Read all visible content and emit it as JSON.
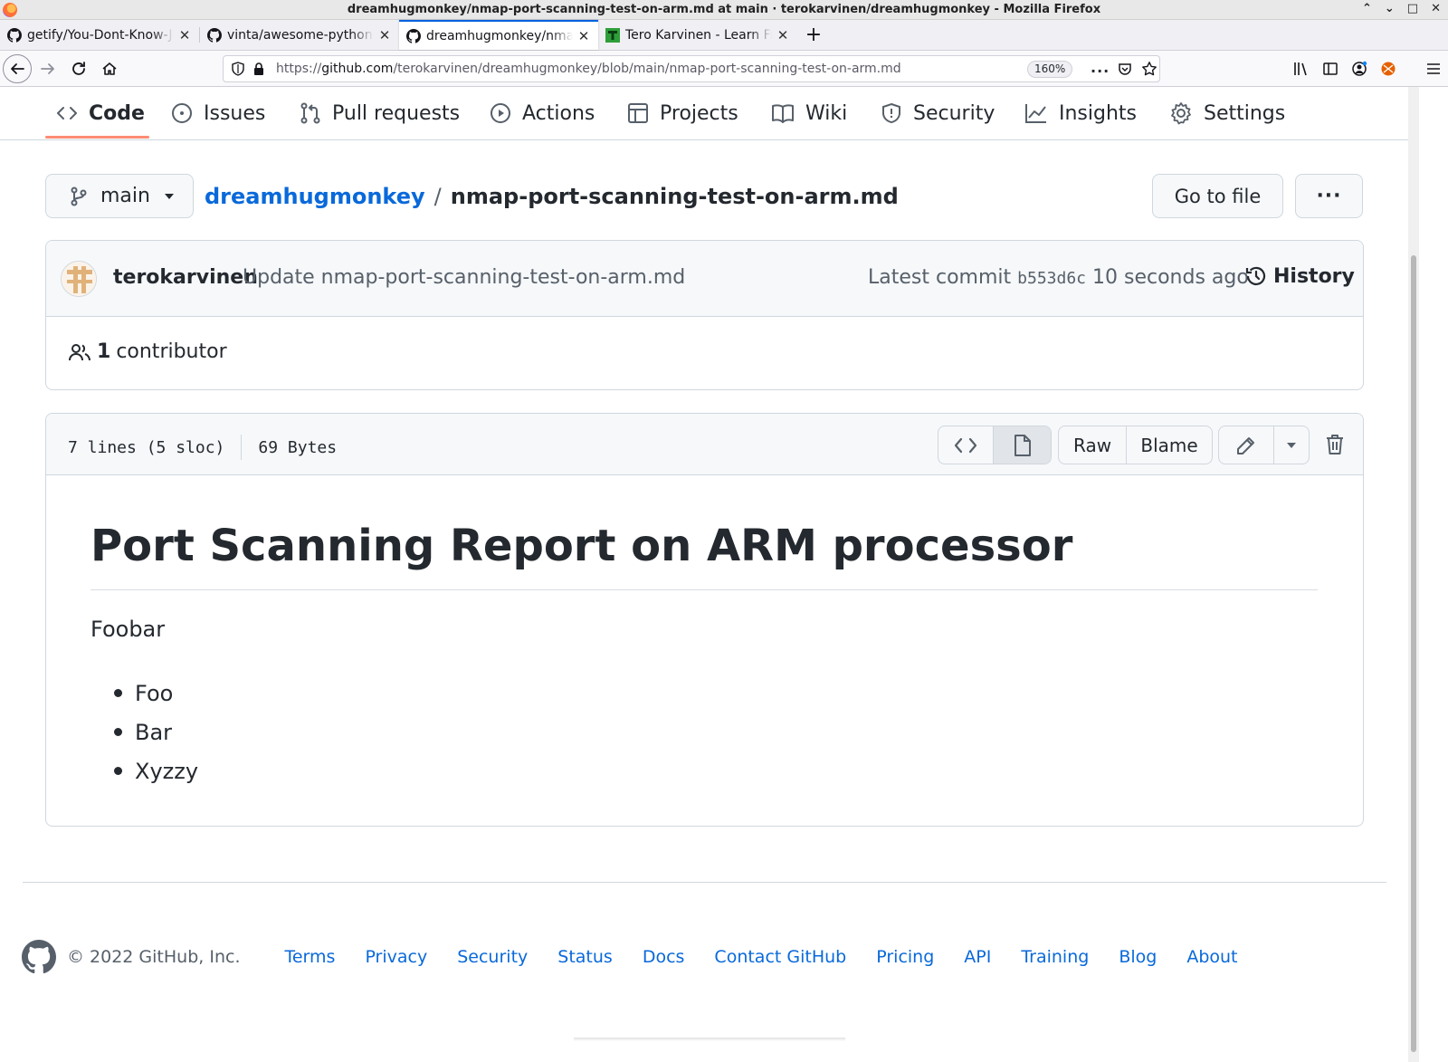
{
  "window": {
    "title": "dreamhugmonkey/nmap-port-scanning-test-on-arm.md at main · terokarvinen/dreamhugmonkey - Mozilla Firefox",
    "controls": [
      "⌃",
      "⌄",
      "□",
      "✕"
    ]
  },
  "tabs": [
    {
      "title": "getify/You-Dont-Know-JS: A",
      "icon": "github-icon",
      "active": false
    },
    {
      "title": "vinta/awesome-python: An",
      "icon": "github-icon",
      "active": false
    },
    {
      "title": "dreamhugmonkey/nmap-port",
      "icon": "github-icon",
      "active": true
    },
    {
      "title": "Tero Karvinen - Learn Free",
      "icon": "tero-favicon",
      "active": false
    }
  ],
  "navbar": {
    "url_prefix": "https://",
    "url_host": "github.com",
    "url_path": "/terokarvinen/dreamhugmonkey/blob/main/nmap-port-scanning-test-on-arm.md",
    "zoom": "160%"
  },
  "repo_nav": {
    "items": [
      {
        "label": "Code",
        "icon": "code-icon",
        "selected": true
      },
      {
        "label": "Issues",
        "icon": "issue-opened-icon"
      },
      {
        "label": "Pull requests",
        "icon": "git-pull-request-icon"
      },
      {
        "label": "Actions",
        "icon": "play-icon"
      },
      {
        "label": "Projects",
        "icon": "table-icon"
      },
      {
        "label": "Wiki",
        "icon": "book-icon"
      },
      {
        "label": "Security",
        "icon": "shield-icon"
      },
      {
        "label": "Insights",
        "icon": "graph-icon"
      },
      {
        "label": "Settings",
        "icon": "gear-icon"
      }
    ]
  },
  "file_nav": {
    "branch": "main",
    "repo": "dreamhugmonkey",
    "separator": "/",
    "file": "nmap-port-scanning-test-on-arm.md",
    "goto_label": "Go to file",
    "more_label": "···"
  },
  "commit": {
    "author": "terokarvinen",
    "message": "Update nmap-port-scanning-test-on-arm.md",
    "latest_label": "Latest commit",
    "sha": "b553d6c",
    "time": "10 seconds ago",
    "history_label": "History",
    "contributors_count": "1",
    "contributors_label": "contributor"
  },
  "file_header": {
    "lines": "7 lines (5 sloc)",
    "size": "69 Bytes",
    "raw_label": "Raw",
    "blame_label": "Blame"
  },
  "markdown": {
    "heading": "Port Scanning Report on ARM processor",
    "paragraph": "Foobar",
    "list": [
      "Foo",
      "Bar",
      "Xyzzy"
    ]
  },
  "footer": {
    "copyright": "© 2022 GitHub, Inc.",
    "links": [
      "Terms",
      "Privacy",
      "Security",
      "Status",
      "Docs",
      "Contact GitHub",
      "Pricing",
      "API",
      "Training",
      "Blog",
      "About"
    ]
  },
  "colors": {
    "link": "#0969da",
    "text": "#24292f",
    "muted": "#57606a",
    "border": "#d0d7de",
    "tab_underline": "#fd8c73",
    "firefox_active_tab": "#0061e0"
  }
}
